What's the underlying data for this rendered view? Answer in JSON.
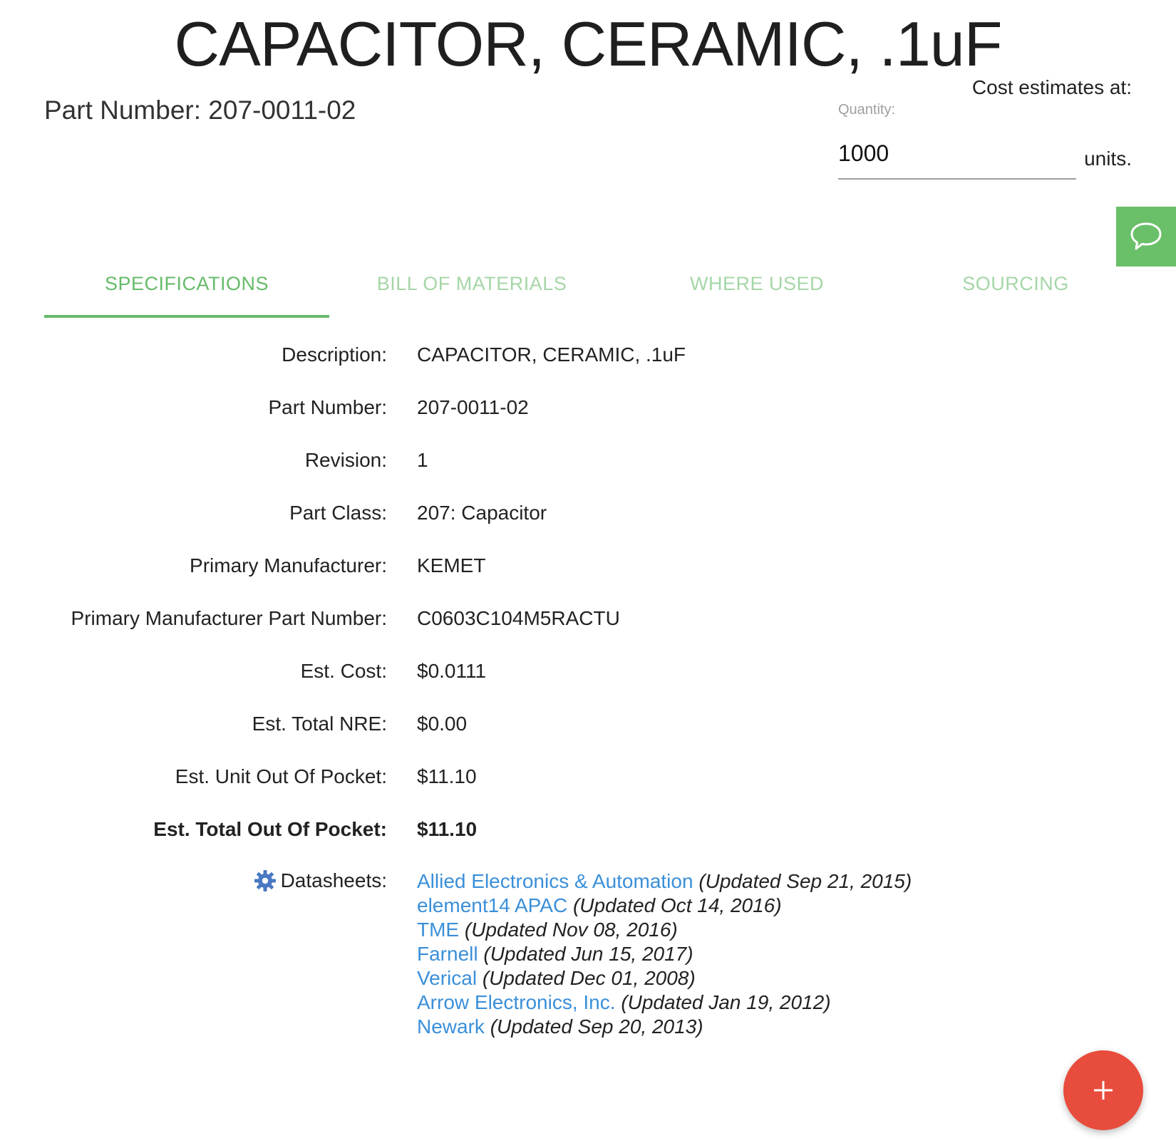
{
  "header": {
    "title": "CAPACITOR, CERAMIC, .1uF",
    "part_number_text": "Part Number: 207-0011-02",
    "cost_estimates_label": "Cost estimates at:",
    "quantity_label": "Quantity:",
    "quantity_value": "1000",
    "units_label": "units."
  },
  "tabs": [
    {
      "label": "SPECIFICATIONS",
      "active": true
    },
    {
      "label": "BILL OF MATERIALS",
      "active": false
    },
    {
      "label": "WHERE USED",
      "active": false
    },
    {
      "label": "SOURCING",
      "active": false
    }
  ],
  "specs": [
    {
      "label": "Description:",
      "value": "CAPACITOR, CERAMIC, .1uF"
    },
    {
      "label": "Part Number:",
      "value": "207-0011-02"
    },
    {
      "label": "Revision:",
      "value": "1"
    },
    {
      "label": "Part Class:",
      "value": "207: Capacitor"
    },
    {
      "label": "Primary Manufacturer:",
      "value": "KEMET"
    },
    {
      "label": "Primary Manufacturer Part Number:",
      "value": "C0603C104M5RACTU"
    },
    {
      "label": "Est. Cost:",
      "value": "$0.0111"
    },
    {
      "label": "Est. Total NRE:",
      "value": "$0.00"
    },
    {
      "label": "Est. Unit Out Of Pocket:",
      "value": "$11.10"
    },
    {
      "label": "Est. Total Out Of Pocket:",
      "value": "$11.10"
    }
  ],
  "datasheets": {
    "label": "Datasheets:",
    "items": [
      {
        "source": "Allied Electronics & Automation",
        "updated": "(Updated Sep 21, 2015)"
      },
      {
        "source": "element14 APAC",
        "updated": "(Updated Oct 14, 2016)"
      },
      {
        "source": "TME",
        "updated": "(Updated Nov 08, 2016)"
      },
      {
        "source": "Farnell",
        "updated": "(Updated Jun 15, 2017)"
      },
      {
        "source": "Verical",
        "updated": "(Updated Dec 01, 2008)"
      },
      {
        "source": "Arrow Electronics, Inc.",
        "updated": "(Updated Jan 19, 2012)"
      },
      {
        "source": "Newark",
        "updated": "(Updated Sep 20, 2013)"
      }
    ]
  },
  "icons": {
    "chat": "chat-bubble-icon",
    "gear": "gear-icon",
    "fab": "plus-icon"
  },
  "colors": {
    "accent_green": "#66bb6a",
    "tab_inactive": "#a5d6a7",
    "link_blue": "#3a8fd9",
    "fab_red": "#e74c3c"
  }
}
